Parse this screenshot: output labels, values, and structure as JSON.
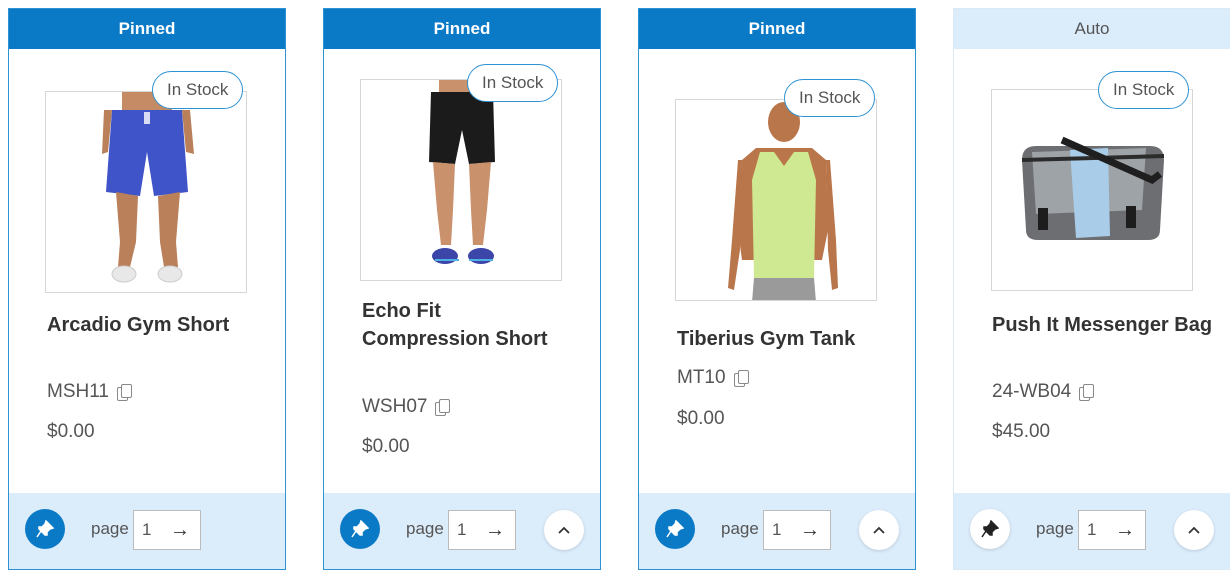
{
  "cards": [
    {
      "mode": "Pinned",
      "badge": "In Stock",
      "name": "Arcadio Gym Short",
      "sku": "MSH11",
      "price": "$0.00",
      "page_label": "page",
      "page_value": "1",
      "pinned": true,
      "image": "blue gym shorts"
    },
    {
      "mode": "Pinned",
      "badge": "In Stock",
      "name": "Echo Fit Compression Short",
      "sku": "WSH07",
      "price": "$0.00",
      "page_label": "page",
      "page_value": "1",
      "pinned": true,
      "image": "black compression shorts"
    },
    {
      "mode": "Pinned",
      "badge": "In Stock",
      "name": "Tiberius Gym Tank",
      "sku": "MT10",
      "price": "$0.00",
      "page_label": "page",
      "page_value": "1",
      "pinned": true,
      "image": "green gym tank"
    },
    {
      "mode": "Auto",
      "badge": "In Stock",
      "name": "Push It Messenger Bag",
      "sku": "24-WB04",
      "price": "$45.00",
      "page_label": "page",
      "page_value": "1",
      "pinned": false,
      "image": "grey and blue messenger bag"
    }
  ],
  "icons": {
    "pin": "pin-icon",
    "copy": "copy-icon",
    "go": "arrow-right-icon",
    "up": "chevron-up-icon"
  },
  "colors": {
    "accent": "#0a79c6",
    "accent_light": "#dbecfb",
    "border": "#2f93d3"
  }
}
